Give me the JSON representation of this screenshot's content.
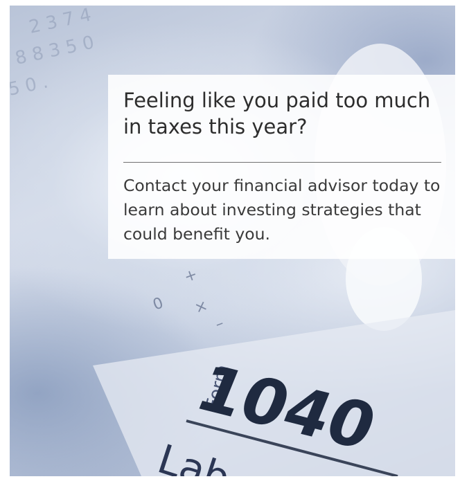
{
  "ad": {
    "headline": "Feeling like you paid too much in taxes this year?",
    "body": "Contact your financial advisor today to learn about investing strategies that could benefit you."
  },
  "photo": {
    "form_label": "Form",
    "form_number": "1040",
    "line_label": "Lab",
    "colors": {
      "tint": "#b9c4d8",
      "ink": "#1f2a40"
    }
  }
}
